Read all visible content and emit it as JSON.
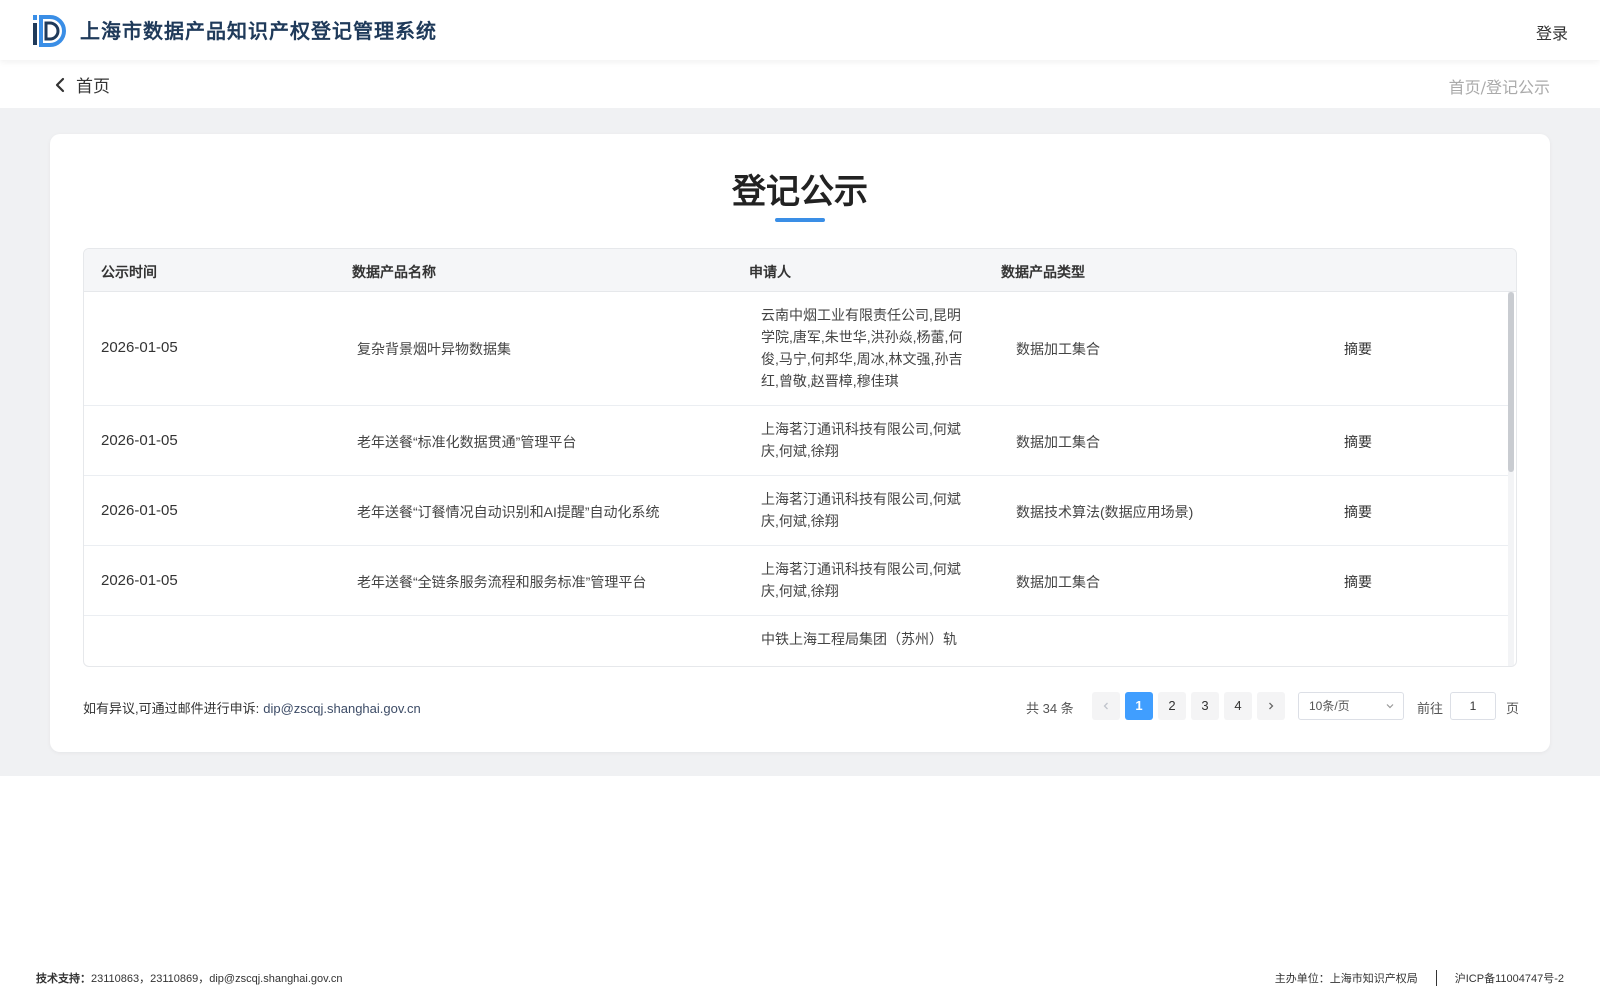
{
  "header": {
    "app_title": "上海市数据产品知识产权登记管理系统",
    "login_label": "登录"
  },
  "subnav": {
    "back_label": "首页",
    "breadcrumb": "首页/登记公示"
  },
  "card": {
    "title": "登记公示",
    "accent_color": "#3a8ee6"
  },
  "table": {
    "columns": [
      "公示时间",
      "数据产品名称",
      "申请人",
      "数据产品类型"
    ],
    "rows": [
      {
        "date": "2026-01-05",
        "name": "复杂背景烟叶异物数据集",
        "applicant_lines": [
          "云南中烟工业有限责任公司,昆明",
          "学院,唐军,朱世华,洪孙焱,杨蕾,何",
          "俊,马宁,何邦华,周冰,林文强,孙吉",
          "红,曾敬,赵晋樟,穆佳琪"
        ],
        "type": "数据加工集合",
        "action": "摘要"
      },
      {
        "date": "2026-01-05",
        "name": "老年送餐“标准化数据贯通”管理平台",
        "applicant_lines": [
          "上海茗汀通讯科技有限公司,何斌",
          "庆,何斌,徐翔"
        ],
        "type": "数据加工集合",
        "action": "摘要"
      },
      {
        "date": "2026-01-05",
        "name": "老年送餐“订餐情况自动识别和AI提醒”自动化系统",
        "applicant_lines": [
          "上海茗汀通讯科技有限公司,何斌",
          "庆,何斌,徐翔"
        ],
        "type": "数据技术算法(数据应用场景)",
        "action": "摘要"
      },
      {
        "date": "2026-01-05",
        "name": "老年送餐“全链条服务流程和服务标准”管理平台",
        "applicant_lines": [
          "上海茗汀通讯科技有限公司,何斌",
          "庆,何斌,徐翔"
        ],
        "type": "数据加工集合",
        "action": "摘要"
      },
      {
        "date": "",
        "name": "",
        "applicant_lines": [
          "中铁上海工程局集团（苏州）轨"
        ],
        "type": "",
        "action": ""
      }
    ]
  },
  "dispute": {
    "text": "如有异议,可通过邮件进行申诉:",
    "email": "dip@zscqj.shanghai.gov.cn"
  },
  "pagination": {
    "total_text": "共 34 条",
    "pages": [
      "1",
      "2",
      "3",
      "4"
    ],
    "current_page": 1,
    "page_size": "10条/页",
    "goto_label": "前往",
    "goto_value": "1",
    "page_suffix": "页"
  },
  "footer": {
    "tech_label": "技术支持：",
    "tech_contacts": "23110863，23110869，dip@zscqj.shanghai.gov.cn",
    "host": "主办单位：上海市知识产权局",
    "icp": "沪ICP备11004747号-2"
  }
}
